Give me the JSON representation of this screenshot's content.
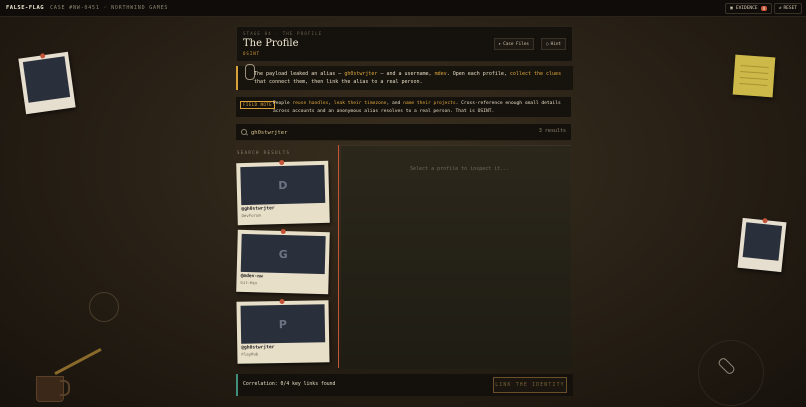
{
  "topbar": {
    "brand": "FALSE-FLAG",
    "case": "CASE #NW-0451 · NORTHWIND GAMES",
    "evidence_label": "EVIDENCE",
    "evidence_count": "4",
    "reset_label": "RESET"
  },
  "header": {
    "stage": "STAGE 04 · THE PROFILE",
    "title": "The Profile",
    "tag": "OSINT",
    "case_files_label": "Case Files",
    "hint_label": "Hint"
  },
  "brief": {
    "t1": "The payload leaked an alias — ",
    "alias": "gh0stwrjter",
    "t2": " — and a username, ",
    "username": "mdev",
    "t3": ". Open each profile, ",
    "collect": "collect the clues",
    "t4": " that connect them, then link the alias to a real person."
  },
  "method": {
    "badge": "FIELD NOTE",
    "t1": "People ",
    "h1": "reuse handles",
    "c1": ", ",
    "h2": "leak their timezone",
    "c2": ", and ",
    "h3": "name their projects",
    "t2": ". Cross-reference enough small details across accounts and an anonymous alias resolves to a real person. That is OSINT."
  },
  "search": {
    "value": "gh0stwrjter",
    "results": "3 results"
  },
  "results_label": "SEARCH RESULTS",
  "profiles": [
    {
      "initial": "D",
      "handle": "@gh0stwrjter",
      "platform": "DevForum"
    },
    {
      "initial": "G",
      "handle": "@mdev-nw",
      "platform": "Git-Hex"
    },
    {
      "initial": "P",
      "handle": "@gh0stwrjter",
      "platform": "PlayHub"
    }
  ],
  "detail": {
    "placeholder": "Select a profile to inspect it..."
  },
  "footer": {
    "correlation": "Correlation: 0/4 key links found",
    "link_button": "LINK THE IDENTITY"
  },
  "colors": {
    "accent": "#d9a13b",
    "alert": "#c4553a",
    "teal": "#3f8f7c"
  }
}
